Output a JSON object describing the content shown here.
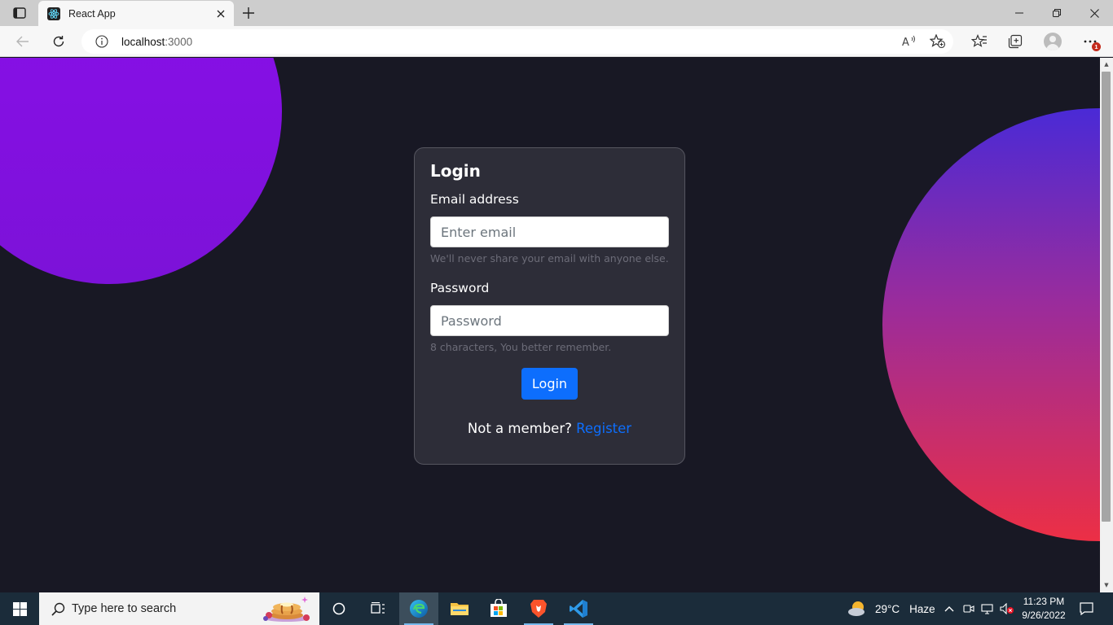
{
  "browser": {
    "tab_title": "React App",
    "url_host": "localhost",
    "url_port": ":3000",
    "notification_count": "1"
  },
  "login": {
    "heading": "Login",
    "email_label": "Email address",
    "email_placeholder": "Enter email",
    "email_help": "We'll never share your email with anyone else.",
    "password_label": "Password",
    "password_placeholder": "Password",
    "password_help": "8 characters, You better remember.",
    "submit_label": "Login",
    "register_prompt": "Not a member?",
    "register_link": "Register"
  },
  "taskbar": {
    "search_placeholder": "Type here to search",
    "weather_temp": "29°C",
    "weather_desc": "Haze",
    "time": "11:23 PM",
    "date": "9/26/2022"
  },
  "colors": {
    "page_bg": "#181824",
    "card_bg": "#2d2d38",
    "accent": "#0d6efd",
    "circle_left": "#8a0eea",
    "circle_right_top": "#4a2ad6",
    "circle_right_bottom": "#ec2f45"
  }
}
